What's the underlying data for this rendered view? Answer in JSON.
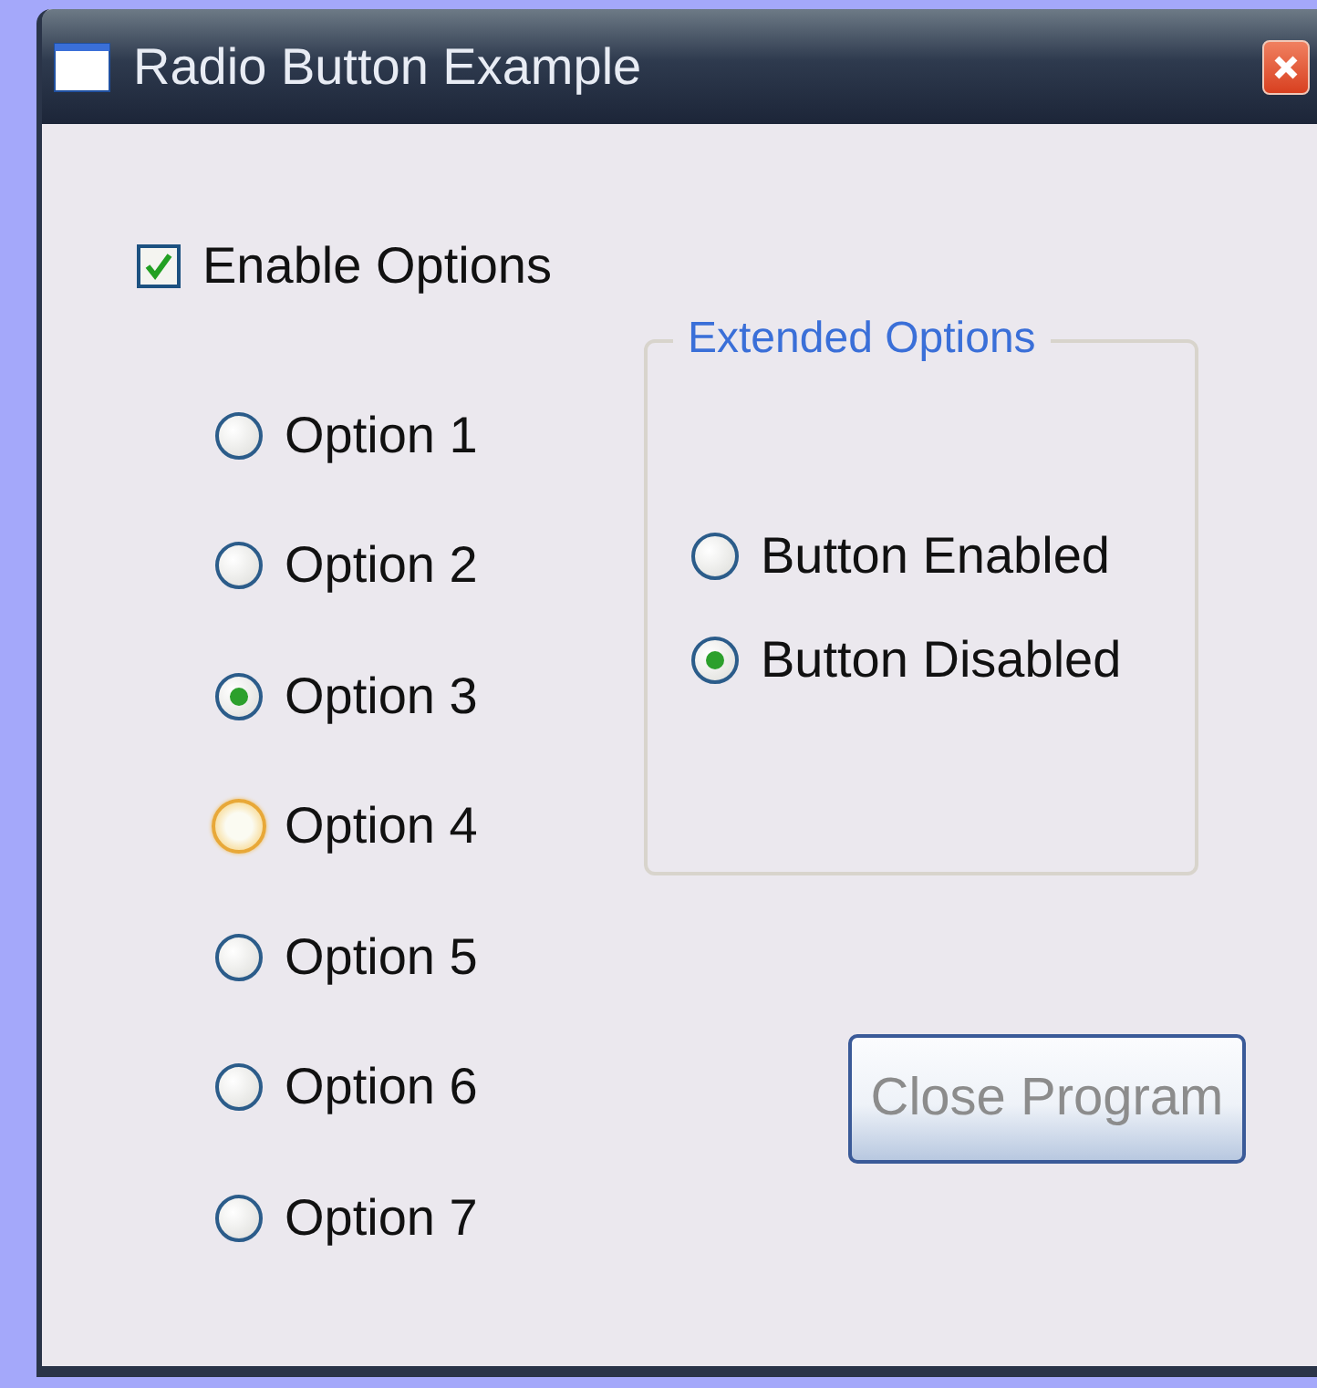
{
  "window": {
    "title": "Radio Button Example"
  },
  "enable_checkbox": {
    "label": "Enable Options",
    "checked": true
  },
  "options": [
    {
      "label": "Option 1",
      "selected": false,
      "hovered": false
    },
    {
      "label": "Option 2",
      "selected": false,
      "hovered": false
    },
    {
      "label": "Option 3",
      "selected": true,
      "hovered": false
    },
    {
      "label": "Option 4",
      "selected": false,
      "hovered": true
    },
    {
      "label": "Option 5",
      "selected": false,
      "hovered": false
    },
    {
      "label": "Option 6",
      "selected": false,
      "hovered": false
    },
    {
      "label": "Option 7",
      "selected": false,
      "hovered": false
    }
  ],
  "extended_options": {
    "title": "Extended Options",
    "options": [
      {
        "label": "Button Enabled",
        "selected": false
      },
      {
        "label": "Button Disabled",
        "selected": true
      }
    ]
  },
  "close_button": {
    "label": "Close Program",
    "disabled": true
  }
}
